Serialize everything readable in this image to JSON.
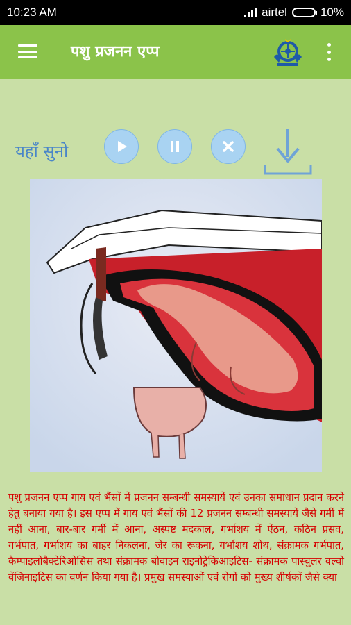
{
  "status_bar": {
    "time": "10:23 AM",
    "carrier": "airtel",
    "battery": "10%"
  },
  "app_bar": {
    "title": "पशु प्रजनन एप्प",
    "menu_icon": "hamburger-menu-icon",
    "logo": "emblem-logo",
    "overflow_icon": "vertical-dots-icon"
  },
  "audio": {
    "label": "यहाँ सुनो",
    "controls": [
      "play-icon",
      "pause-icon",
      "close-icon",
      "download-icon"
    ]
  },
  "illustration": {
    "subject": "cow-pregnancy-cross-section"
  },
  "description": "पशु प्रजनन एप्प गाय एवं भैंसों में प्रजनन सम्बन्धी समस्यायें एवं उनका समाधान प्रदान करने हेतु बनाया गया है। इस एप्प में गाय एवं भैंसों की 12 प्रजनन सम्बन्धी समस्यायें जैसे गर्मी में नहीं आना, बार-बार गर्मी में आना, अस्पष्ट मदकाल, गर्भाशय में ऐंठन, कठिन प्रसव, गर्भपात, गर्भाशय का बाहर निकलना, जेर का रूकना, गर्भाशय शोथ, संक्रामक गर्भपात, कैम्पाइलोबैक्टेरिओसिस तथा संक्रामक बोवाइन राइनोट्रेकिआइटिस- संक्रामक पास्चुलर वल्वो वेंजिनाइटिस का वर्णन किया गया है। प्रमुख समस्याओं एवं रोगों को मुख्य शीर्षकों जैसे क्या"
}
